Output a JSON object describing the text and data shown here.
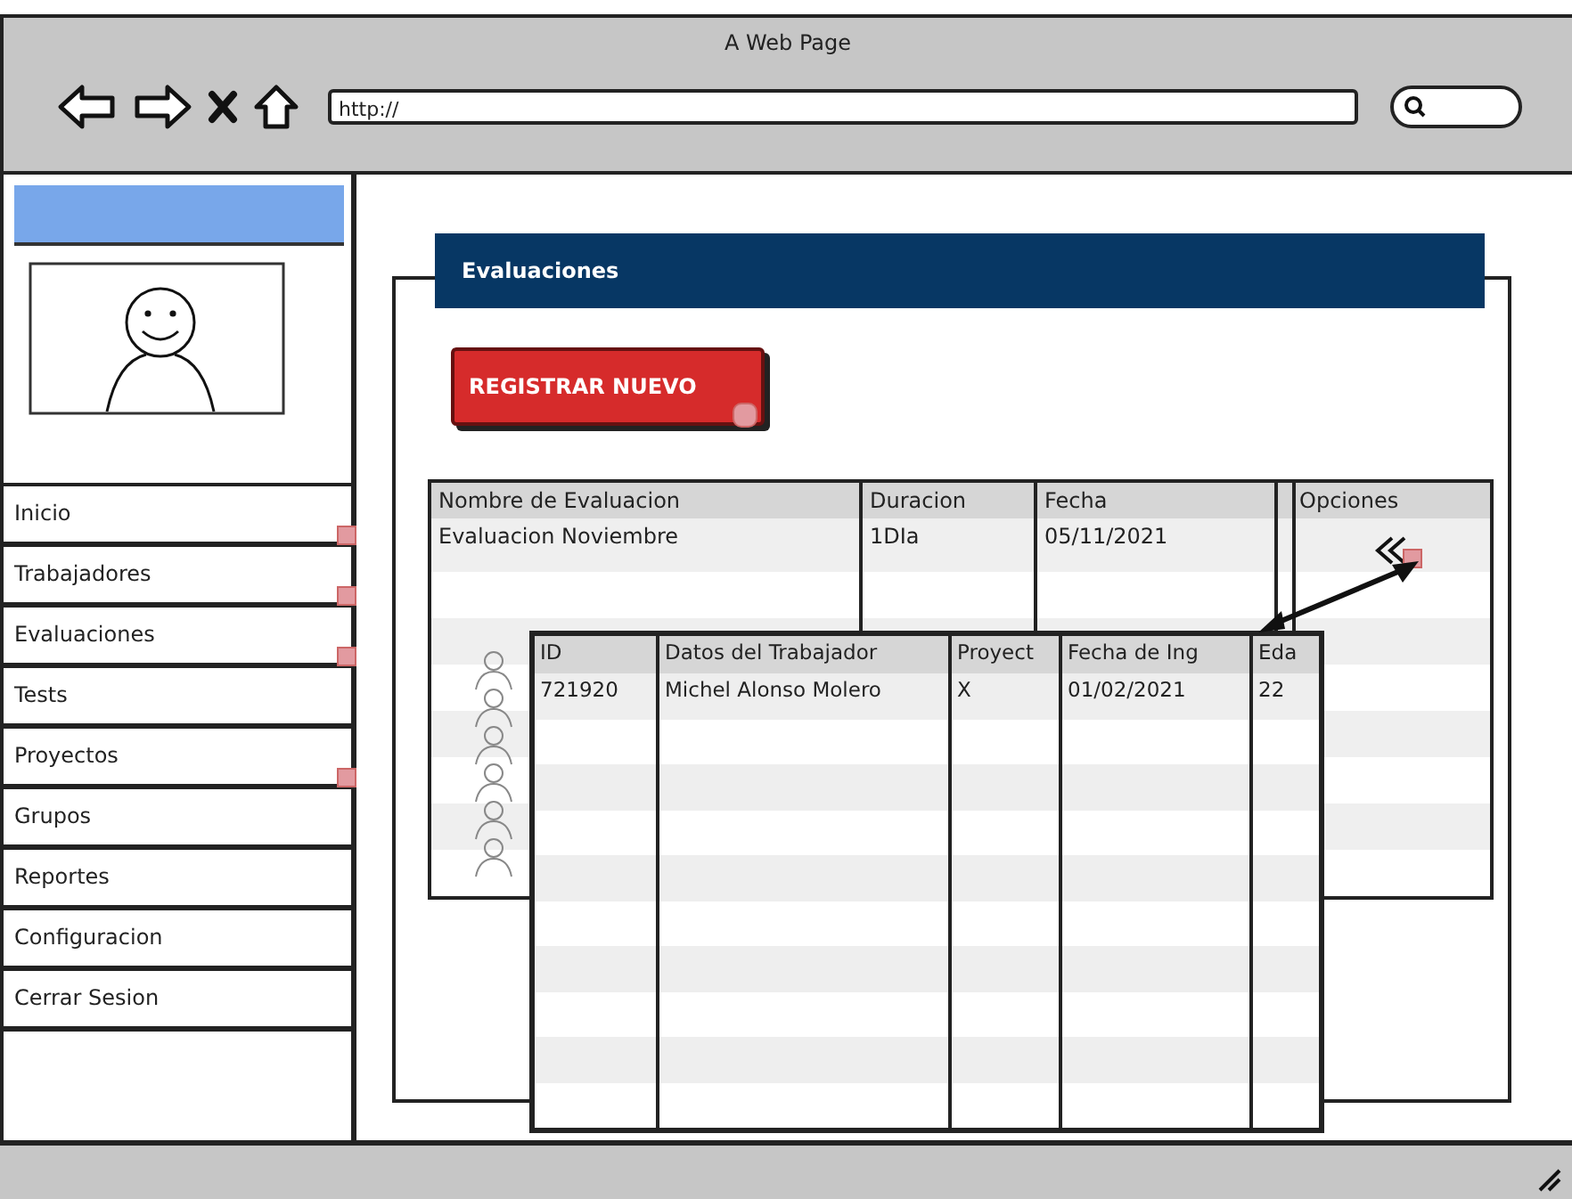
{
  "browser": {
    "title": "A Web Page",
    "url": "http://"
  },
  "sidebar": {
    "items": [
      {
        "label": "Inicio",
        "linked": true
      },
      {
        "label": "Trabajadores",
        "linked": true
      },
      {
        "label": "Evaluaciones",
        "linked": true
      },
      {
        "label": "Tests",
        "linked": false
      },
      {
        "label": "Proyectos",
        "linked": true
      },
      {
        "label": "Grupos",
        "linked": false
      },
      {
        "label": "Reportes",
        "linked": false
      },
      {
        "label": "Configuracion",
        "linked": false
      },
      {
        "label": "Cerrar Sesion",
        "linked": false
      }
    ]
  },
  "panel": {
    "title": "Evaluaciones",
    "button": {
      "label": "REGISTRAR NUEVO",
      "linked": true
    },
    "table": {
      "columns": [
        "Nombre de Evaluacion",
        "Duracion",
        "Fecha",
        "Opciones"
      ],
      "rows": [
        {
          "cells": [
            "Evaluacion Noviembre",
            "1DIa",
            "05/11/2021"
          ],
          "linked": true
        }
      ]
    }
  },
  "popup_table": {
    "columns": [
      "ID",
      "Datos del Trabajador",
      "Proyect",
      "Fecha de Ing",
      "Eda"
    ],
    "rows": [
      {
        "cells": [
          "721920",
          "Michel Alonso Molero",
          "X",
          "01/02/2021",
          "22"
        ]
      }
    ]
  }
}
